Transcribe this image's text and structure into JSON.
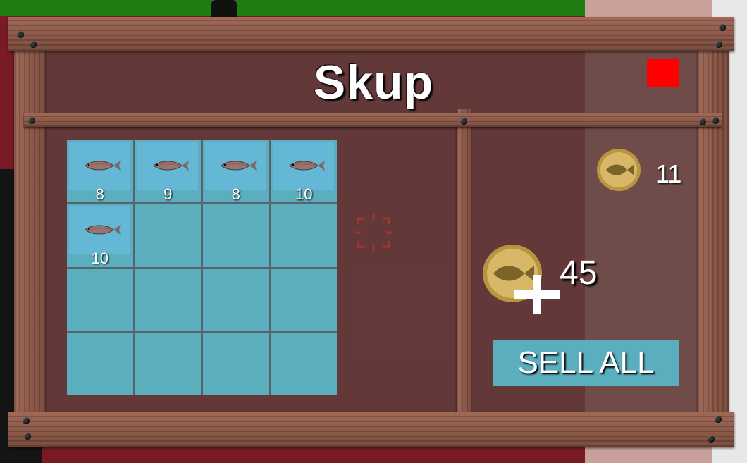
{
  "title": "Skup",
  "colors": {
    "close_button": "#ff0000",
    "slot": "#5aaebe",
    "slot_filled": "#65b7d6",
    "board_wood": "#8a5a4a",
    "coin": "#d8b868",
    "crosshair": "#c0302a"
  },
  "inventory": {
    "slots": [
      {
        "item": "fish",
        "count": "8"
      },
      {
        "item": "fish",
        "count": "9"
      },
      {
        "item": "fish",
        "count": "8"
      },
      {
        "item": "fish",
        "count": "10"
      },
      {
        "item": "fish",
        "count": "10"
      },
      {
        "item": "",
        "count": ""
      },
      {
        "item": "",
        "count": ""
      },
      {
        "item": "",
        "count": ""
      },
      {
        "item": "",
        "count": ""
      },
      {
        "item": "",
        "count": ""
      },
      {
        "item": "",
        "count": ""
      },
      {
        "item": "",
        "count": ""
      },
      {
        "item": "",
        "count": ""
      },
      {
        "item": "",
        "count": ""
      },
      {
        "item": "",
        "count": ""
      },
      {
        "item": "",
        "count": ""
      }
    ]
  },
  "price": {
    "value": "11",
    "icon": "fish-coin-icon"
  },
  "total": {
    "value": "45",
    "icon": "fish-coin-icon"
  },
  "sell_all_label": "SELL ALL"
}
